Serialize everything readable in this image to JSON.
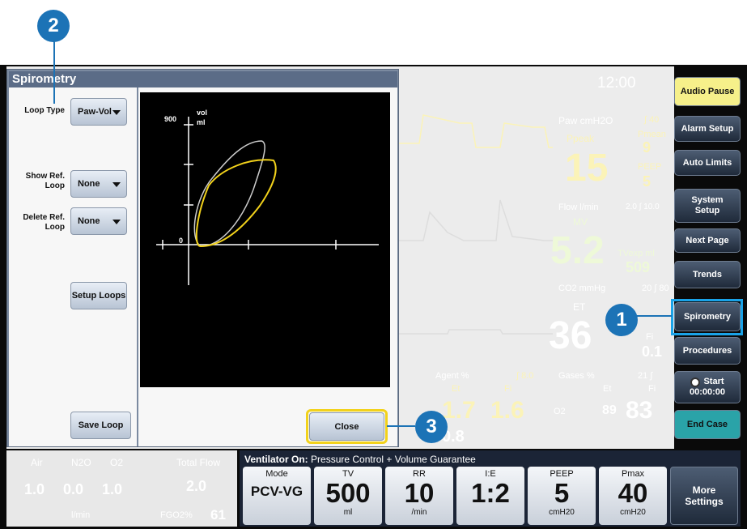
{
  "clock": "12:00",
  "sidebar": {
    "items": [
      {
        "label": "Audio Pause"
      },
      {
        "label": "Alarm Setup"
      },
      {
        "label": "Auto Limits"
      },
      {
        "label": "System Setup"
      },
      {
        "label": "Next Page"
      },
      {
        "label": "Trends"
      },
      {
        "label": "Spirometry"
      },
      {
        "label": "Procedures"
      },
      {
        "label": "Start",
        "sub": "00:00:00"
      },
      {
        "label": "End Case"
      }
    ]
  },
  "numerics": {
    "paw_label": "Paw cmH2O",
    "paw_limit": "∫ 40",
    "ppeak_label": "Ppeak",
    "ppeak_value": "15",
    "pmean_label": "Pmean",
    "pmean_value": "9",
    "peep_label": "PEEP",
    "peep_value": "5",
    "flow_label": "Flow l/min",
    "flow_limits": "2.0 ∫ 10.0",
    "mv_label": "MV",
    "mv_value": "5.2",
    "tvexp_label": "TVexp ml",
    "tvexp_value": "509",
    "co2_label": "CO2 mmHg",
    "co2_limits": "20 ∫ 80",
    "et_label": "ET",
    "et_value": "36",
    "fi_label": "Fi",
    "fi_value": "0.1",
    "agent_label": "Agent %",
    "agent_limit": "∫ 8.0",
    "agent_et_label": "Et",
    "agent_fi_label": "Fi",
    "agent_et_value": "1.7",
    "agent_fi_value": "1.6",
    "agent_sub_value": "0.8",
    "gases_label": "Gases %",
    "gases_limits": "21 ∫",
    "gases_et_label": "Et",
    "gases_fi_label": "Fi",
    "o2_label": "O2",
    "o2_et": "89",
    "o2_fi": "83"
  },
  "flows": {
    "air_label": "Air",
    "n2o_label": "N2O",
    "o2_label": "O2",
    "air_value": "1.0",
    "n2o_value": "0.0",
    "o2_value": "1.0",
    "unit": "l/min",
    "total_label": "Total Flow",
    "total_value": "2.0",
    "fgo2_label": "FGO2%",
    "fgo2_value": "61"
  },
  "ventilator": {
    "title_prefix": "Ventilator On:",
    "title_mode": "Pressure Control + Volume Guarantee",
    "cells": [
      {
        "label": "Mode",
        "value": "PCV-VG",
        "unit": ""
      },
      {
        "label": "TV",
        "value": "500",
        "unit": "ml"
      },
      {
        "label": "RR",
        "value": "10",
        "unit": "/min"
      },
      {
        "label": "I:E",
        "value": "1:2",
        "unit": ""
      },
      {
        "label": "PEEP",
        "value": "5",
        "unit": "cmH20"
      },
      {
        "label": "Pmax",
        "value": "40",
        "unit": "cmH20"
      }
    ],
    "more_label": "More Settings"
  },
  "dialog": {
    "title": "Spirometry",
    "loop_type_label": "Loop Type",
    "loop_type_value": "Paw-Vol",
    "show_ref_label": "Show Ref. Loop",
    "show_ref_value": "None",
    "delete_ref_label": "Delete Ref. Loop",
    "delete_ref_value": "None",
    "setup_loops_label": "Setup Loops",
    "save_loop_label": "Save Loop",
    "close_label": "Close",
    "plot": {
      "y_max_label": "900",
      "y_unit": "vol",
      "y_unit2": "ml",
      "zero_label": "0",
      "loop_colors": {
        "current": "#f2d21b",
        "reference": "#cccccc"
      }
    }
  },
  "callouts": [
    "1",
    "2",
    "3"
  ],
  "colors": {
    "highlight": "#1aa3e8",
    "yellow_highlight": "#f2d21b",
    "audio_pause": "#f6f08a",
    "end_case": "#2aa3a8"
  }
}
